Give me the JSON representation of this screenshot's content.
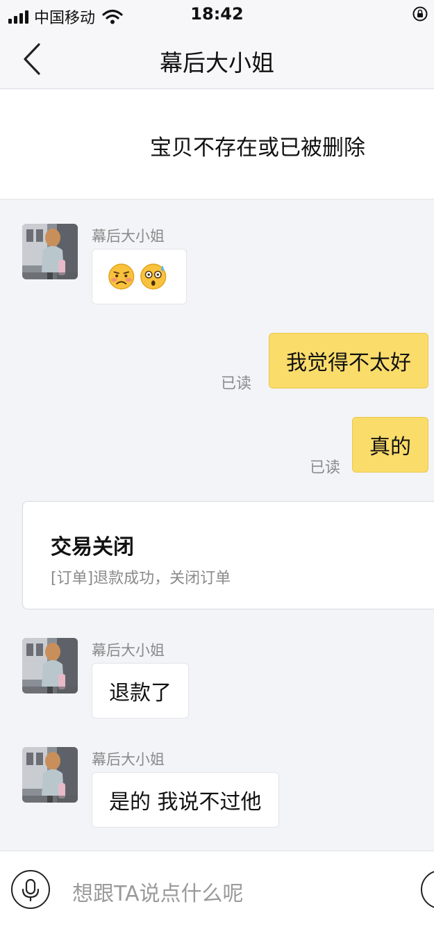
{
  "status_bar": {
    "carrier": "中国移动",
    "time": "18:42"
  },
  "nav": {
    "title": "幕后大小姐"
  },
  "item_banner": {
    "text": "宝贝不存在或已被删除"
  },
  "messages": [
    {
      "sender": "幕后大小姐",
      "content": "",
      "content_icons": [
        "worried-face-emoji",
        "anxious-sweat-face-emoji"
      ]
    },
    {
      "text": "我觉得不太好",
      "read": "已读"
    },
    {
      "text": "真的",
      "read": "已读"
    },
    {
      "sender": "幕后大小姐",
      "text": "退款了"
    },
    {
      "sender": "幕后大小姐",
      "text": "是的 我说不过他"
    }
  ],
  "order_card": {
    "title": "交易关闭",
    "subtitle": "[订单]退款成功，关闭订单"
  },
  "input": {
    "placeholder": "想跟TA说点什么呢"
  },
  "colors": {
    "outgoing_bubble": "#fadc6b",
    "background": "#f3f4f7"
  },
  "icons": [
    "signal-icon",
    "wifi-icon",
    "lock-rotation-icon",
    "back-chevron-icon",
    "microphone-icon",
    "emoji-button-icon"
  ]
}
